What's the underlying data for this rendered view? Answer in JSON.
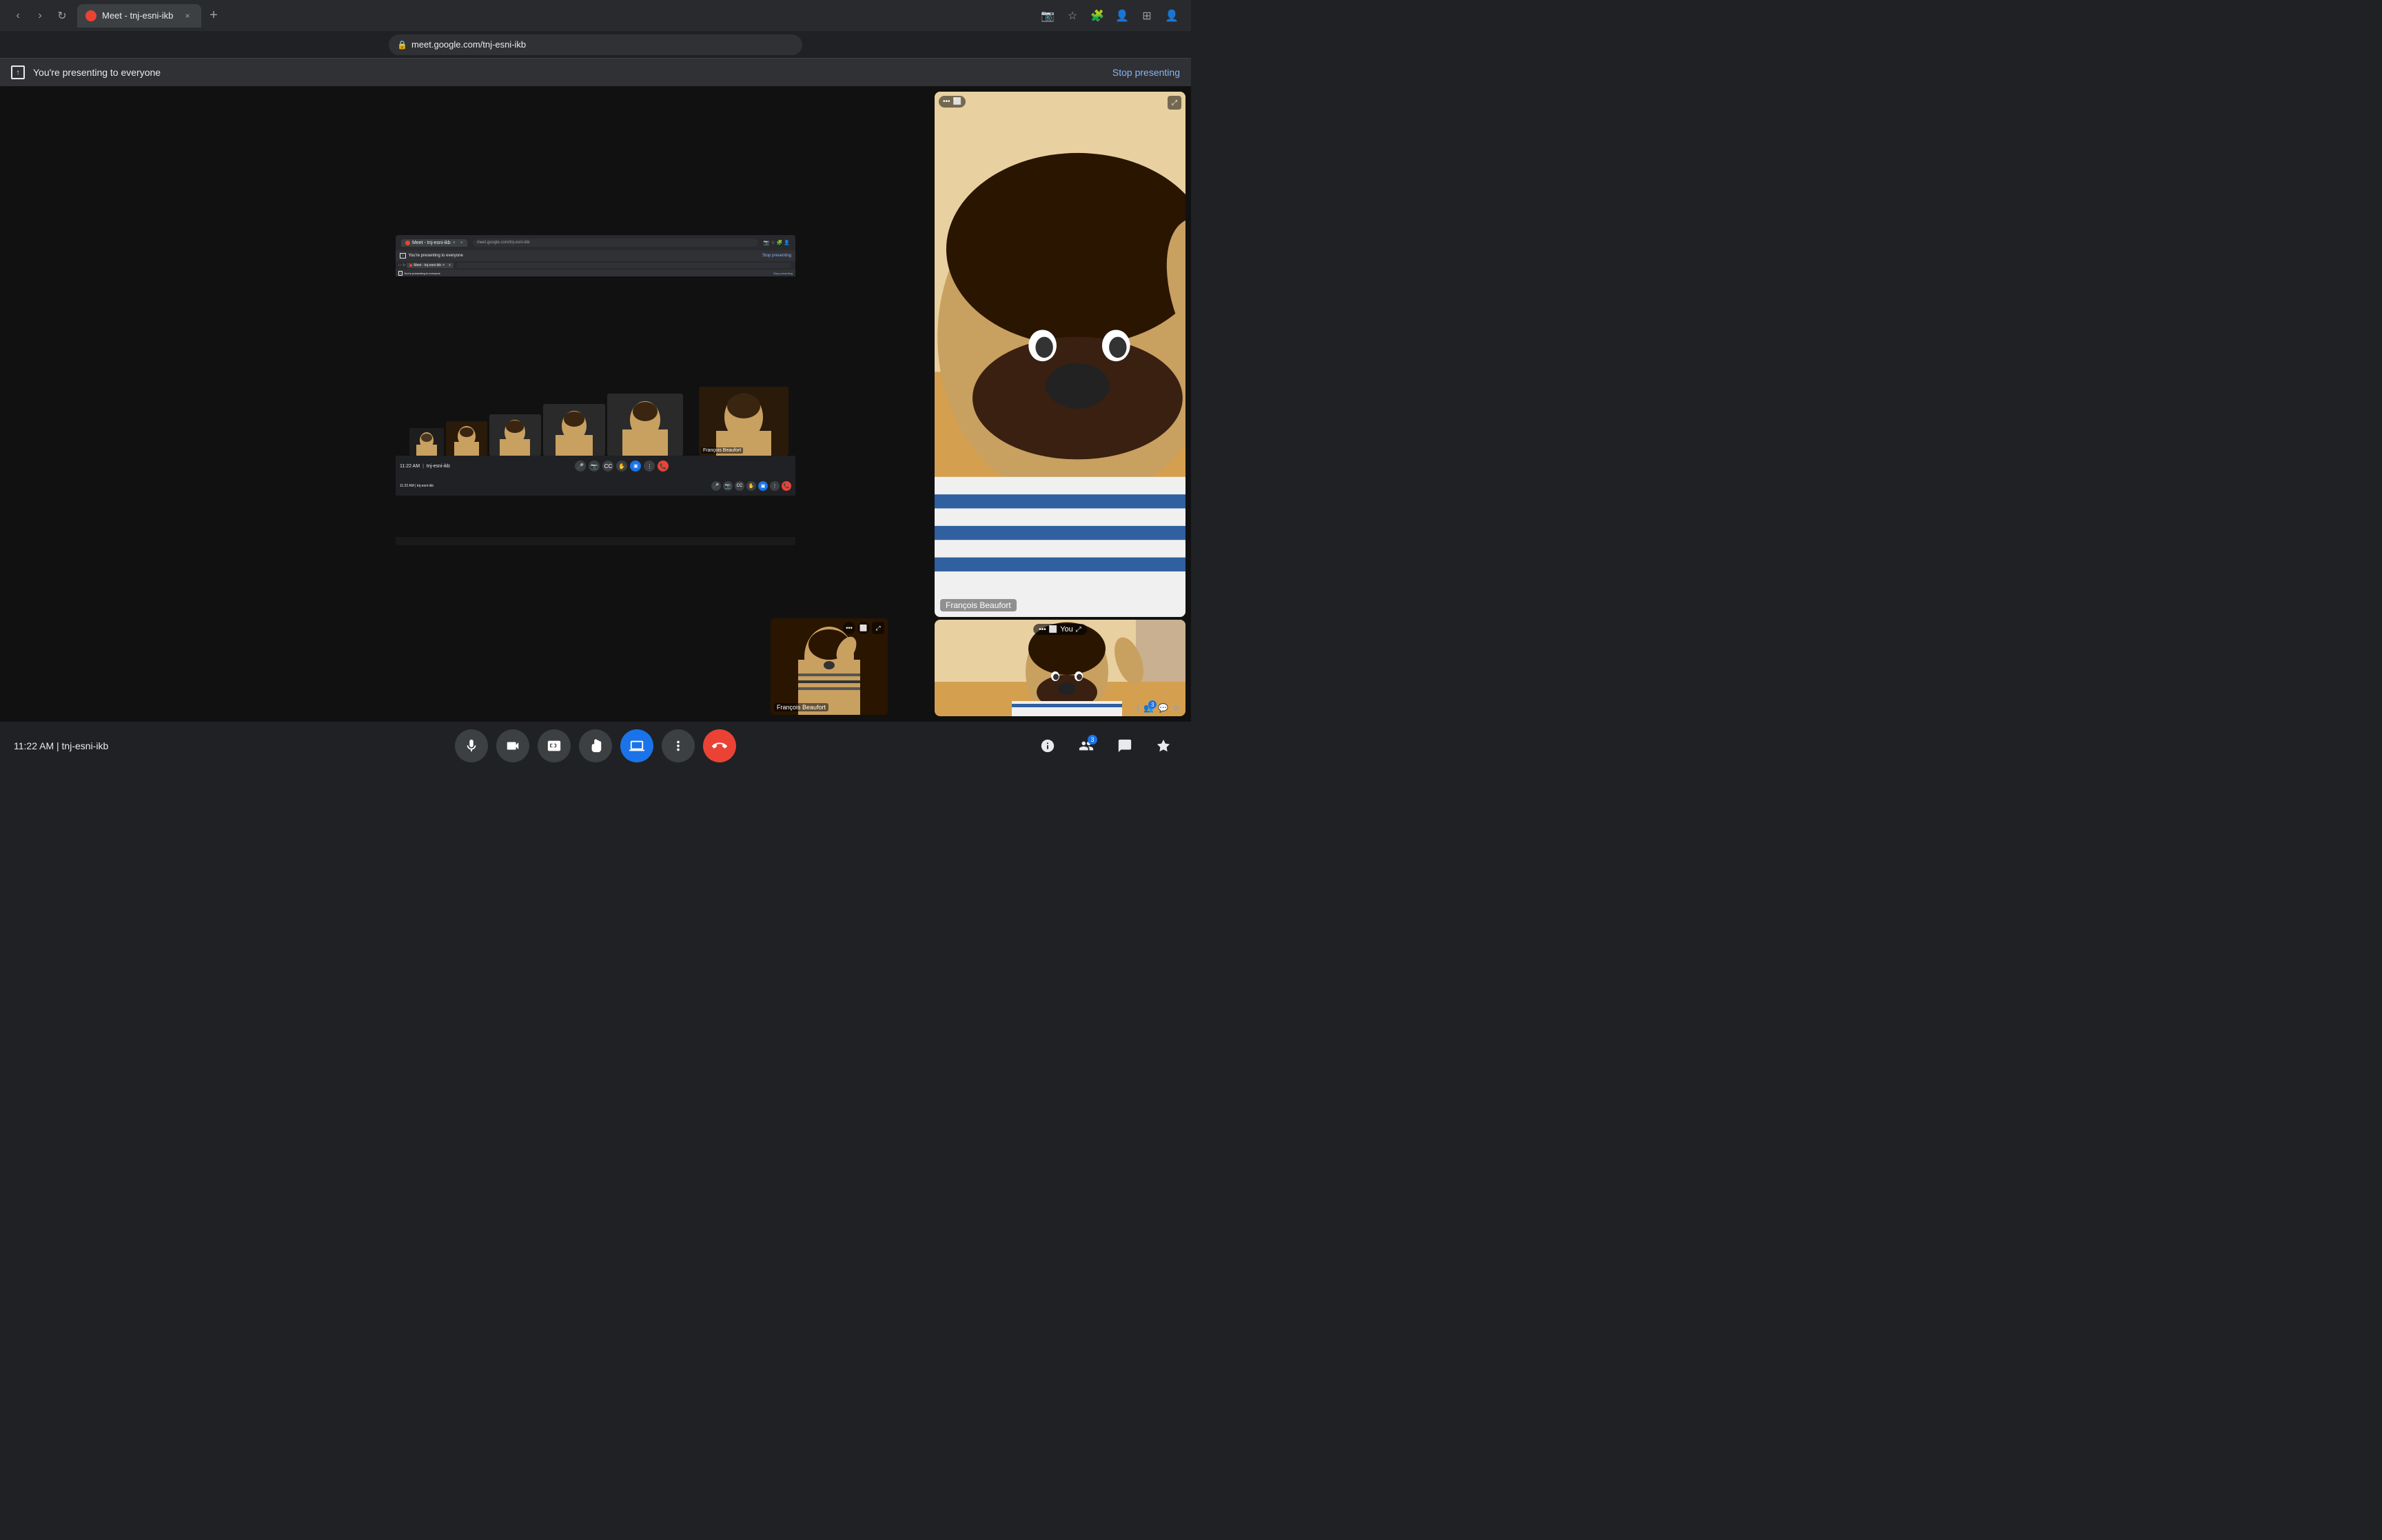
{
  "browser": {
    "tab_title": "Meet - tnj-esni-ikb",
    "tab_close": "×",
    "new_tab": "+",
    "url": "meet.google.com/tnj-esni-ikb",
    "back_btn": "←",
    "forward_btn": "→",
    "reload_btn": "↻",
    "more_btn": "⋮"
  },
  "presentation_banner": {
    "text": "You're presenting to everyone",
    "stop_btn": "Stop presenting",
    "icon": "⬆"
  },
  "nested_banner": {
    "text": "You're presenting to everyone",
    "stop_btn": "Stop presenting"
  },
  "participants": {
    "francois_label": "François Beaufort",
    "you_label": "You"
  },
  "bottom_bar": {
    "time": "11:22 AM",
    "meeting_id": "tnj-esni-ikb",
    "separator": "|"
  },
  "controls": {
    "mic_label": "Microphone",
    "camera_label": "Camera",
    "captions_label": "Captions",
    "raise_hand_label": "Raise hand",
    "present_label": "Present now",
    "more_label": "More options",
    "end_call_label": "Leave call"
  },
  "right_controls": {
    "info_label": "Meeting details",
    "people_label": "People",
    "people_badge": "3",
    "chat_label": "Chat",
    "activities_label": "Activities"
  },
  "tile_controls": {
    "more": "•••",
    "pip": "⬜",
    "you": "You",
    "expand": "⤢",
    "francois": "François Beaufort"
  }
}
